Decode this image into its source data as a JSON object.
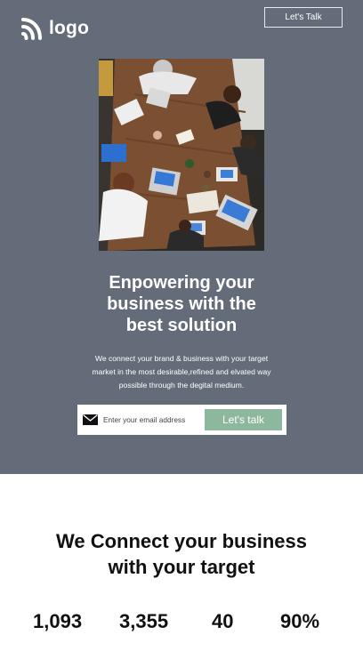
{
  "header": {
    "logo_text": "logo",
    "cta_label": "Let's Talk"
  },
  "hero": {
    "headline_line1": "Enpowering your",
    "headline_line2": "business with the",
    "headline_line3": "best solution",
    "description_line1": "We connect your brand & business with your target",
    "description_line2": "market in the most desirable,refined and elvated way",
    "description_line3": "possible through the degital medium.",
    "email_placeholder": "Enter your email address",
    "submit_label": "Let's talk"
  },
  "connect": {
    "title_line1": "We Connect your business",
    "title_line2": "with your target"
  },
  "stats": [
    "1,093",
    "3,355",
    "40",
    "90%"
  ],
  "colors": {
    "hero_background": "#636c78",
    "accent_button": "#8db89e",
    "page_background": "#ffffff"
  }
}
